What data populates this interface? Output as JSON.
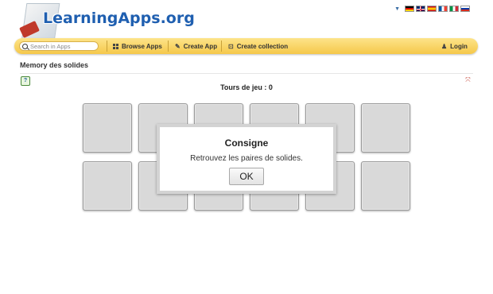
{
  "header": {
    "logo_text": "LearningApps.org",
    "languages": [
      {
        "code": "de",
        "colors": [
          "#000000",
          "#dd0000",
          "#ffce00"
        ]
      },
      {
        "code": "en",
        "colors": [
          "#012169",
          "#c8102e",
          "#ffffff"
        ]
      },
      {
        "code": "es",
        "colors": [
          "#c60b1e",
          "#ffc400",
          "#c60b1e"
        ]
      },
      {
        "code": "fr",
        "colors": [
          "#0055a4",
          "#ffffff",
          "#ef4135"
        ]
      },
      {
        "code": "it",
        "colors": [
          "#009246",
          "#ffffff",
          "#ce2b37"
        ]
      },
      {
        "code": "ru",
        "colors": [
          "#ffffff",
          "#0039a6",
          "#d52b1e"
        ]
      }
    ]
  },
  "nav": {
    "search_placeholder": "Search in Apps",
    "browse": "Browse Apps",
    "create_app": "Create App",
    "create_collection": "Create collection",
    "login": "Login"
  },
  "app": {
    "title": "Memory des solides",
    "rounds_label": "Tours de jeu : 0"
  },
  "board": {
    "rows": 2,
    "cols": 6,
    "card_color": "#d9d9d9"
  },
  "dialog": {
    "title": "Consigne",
    "text": "Retrouvez les paires de solides.",
    "button": "OK"
  },
  "colors": {
    "navbar": "#f5c84a",
    "logo": "#1f5fb0"
  }
}
